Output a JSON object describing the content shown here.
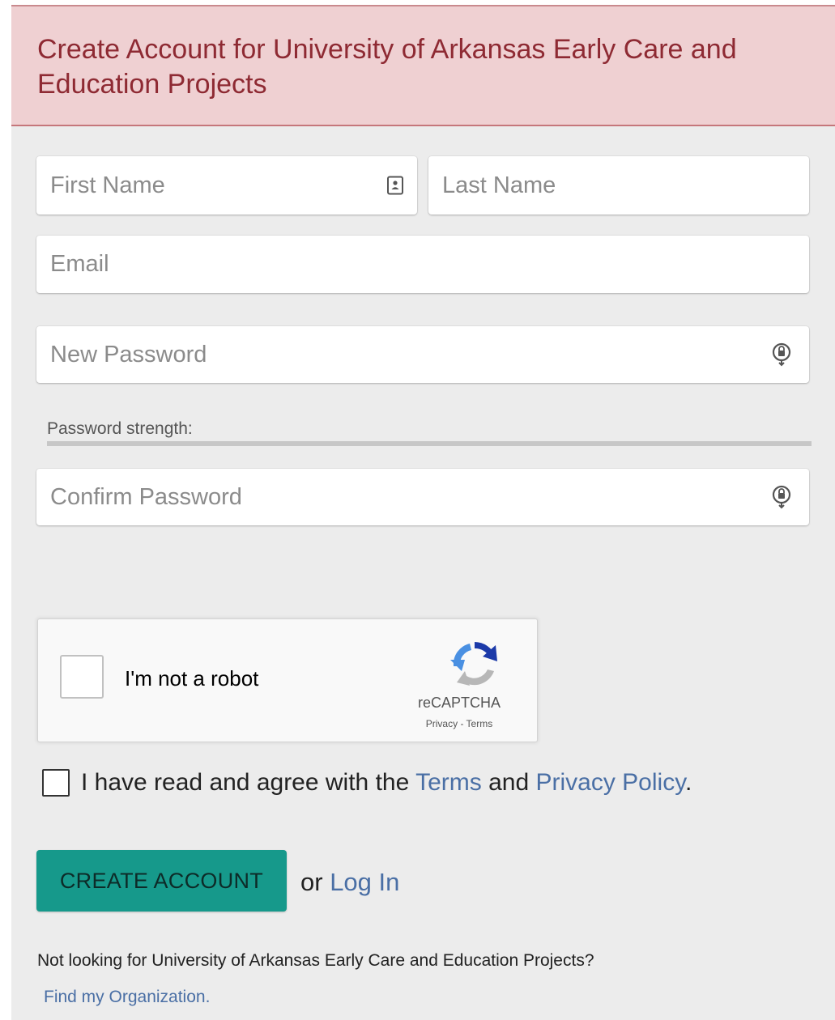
{
  "header": {
    "title": "Create Account for University of Arkansas Early Care and Education Projects"
  },
  "form": {
    "first_name": {
      "placeholder": "First Name",
      "value": "",
      "icon": "contact-card-icon"
    },
    "last_name": {
      "placeholder": "Last Name",
      "value": ""
    },
    "email": {
      "placeholder": "Email",
      "value": ""
    },
    "new_password": {
      "placeholder": "New Password",
      "value": "",
      "icon": "password-key-icon"
    },
    "password_strength_label": "Password strength:",
    "confirm_password": {
      "placeholder": "Confirm Password",
      "value": "",
      "icon": "password-key-icon"
    }
  },
  "recaptcha": {
    "label": "I'm not a robot",
    "brand": "reCAPTCHA",
    "links": "Privacy - Terms",
    "checked": false
  },
  "agreement": {
    "prefix": "I have read and agree with the ",
    "terms_link": "Terms",
    "middle": " and ",
    "privacy_link": "Privacy Policy",
    "suffix": ".",
    "checked": false
  },
  "actions": {
    "create_label": "CREATE ACCOUNT",
    "or_text": "or ",
    "login_link": "Log In"
  },
  "footer": {
    "not_looking": "Not looking for University of Arkansas Early Care and Education Projects?",
    "find_org": "Find my Organization."
  },
  "colors": {
    "header_bg": "#efd0d2",
    "header_text": "#8e2a33",
    "primary_button": "#16998b",
    "link": "#4a6fa5",
    "panel_bg": "#ececec"
  }
}
